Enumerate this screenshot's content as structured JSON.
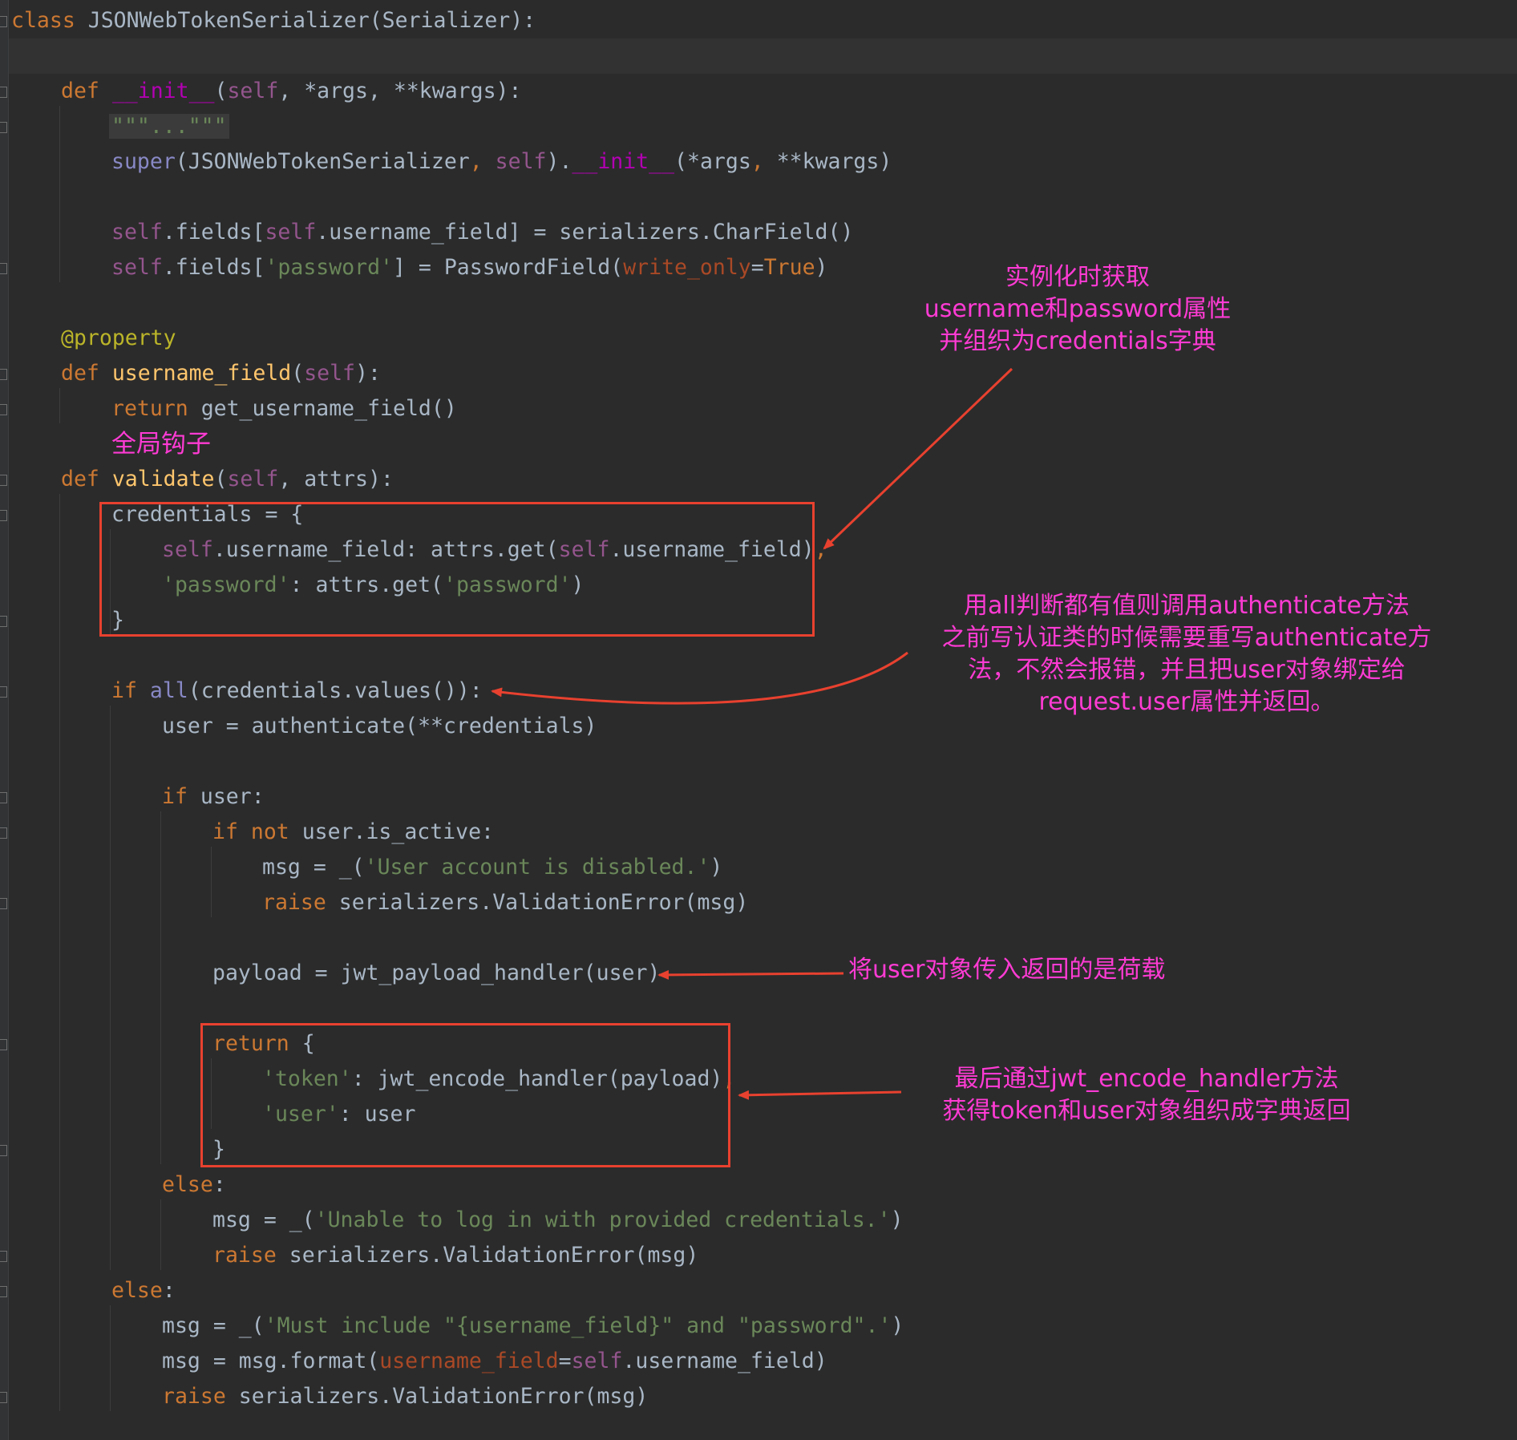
{
  "colors": {
    "background": "#2b2b2b",
    "keyword": "#cc7832",
    "function": "#ffc66d",
    "string": "#6a8759",
    "self": "#94558d",
    "annotation": "#ff3bd4",
    "box": "#e8412f"
  },
  "code": {
    "l01": {
      "a": "class",
      "b": " JSONWebTokenSerializer(Serializer):"
    },
    "l03": {
      "a": "def",
      "b": "__init__",
      "c": "(",
      "d": "self",
      "e": ", *args",
      "f": ", ",
      "g": "**kwargs):"
    },
    "l04": {
      "a": "\"\"\"...\"\"\""
    },
    "l05": {
      "a": "super",
      "b": "(JSONWebTokenSerializer",
      "c": ", ",
      "d": "self",
      "e": ").",
      "f": "__init__",
      "g": "(*args",
      "h": ", ",
      "i": "**kwargs)"
    },
    "l07": {
      "a": "self",
      "b": ".fields[",
      "c": "self",
      "d": ".username_field] = serializers.CharField()"
    },
    "l08": {
      "a": "self",
      "b": ".fields[",
      "c": "'password'",
      "d": "] = PasswordField(",
      "e": "write_only",
      "f": "=",
      "g": "True",
      "h": ")"
    },
    "l10": {
      "a": "@property"
    },
    "l11": {
      "a": "def",
      "b": "username_field",
      "c": "(",
      "d": "self",
      "e": "):"
    },
    "l12": {
      "a": "return",
      "b": " get_username_field()"
    },
    "l13": {
      "a": "全局钩子"
    },
    "l14": {
      "a": "def",
      "b": "validate",
      "c": "(",
      "d": "self",
      "e": ", attrs):"
    },
    "l15": {
      "a": "credentials = {"
    },
    "l16": {
      "a": "self",
      "b": ".username_field: attrs.get(",
      "c": "self",
      "d": ".username_field)",
      "e": ","
    },
    "l17": {
      "a": "'password'",
      "b": ": attrs.get(",
      "c": "'password'",
      "d": ")"
    },
    "l18": {
      "a": "}"
    },
    "l20": {
      "a": "if",
      "b": " ",
      "c": "all",
      "d": "(credentials.values()):"
    },
    "l21": {
      "a": "user = authenticate(**credentials)"
    },
    "l23": {
      "a": "if",
      "b": " user:"
    },
    "l24": {
      "a": "if not",
      "b": " user.is_active:"
    },
    "l25": {
      "a": "msg = _(",
      "b": "'User account is disabled.'",
      "c": ")"
    },
    "l26": {
      "a": "raise",
      "b": " serializers.ValidationError(msg)"
    },
    "l28": {
      "a": "payload = jwt_payload_handler(user)"
    },
    "l30": {
      "a": "return",
      "b": " {"
    },
    "l31": {
      "a": "'token'",
      "b": ": jwt_encode_handler(payload)",
      "c": ","
    },
    "l32": {
      "a": "'user'",
      "b": ": user"
    },
    "l33": {
      "a": "}"
    },
    "l34": {
      "a": "else",
      "b": ":"
    },
    "l35": {
      "a": "msg = _(",
      "b": "'Unable to log in with provided credentials.'",
      "c": ")"
    },
    "l36": {
      "a": "raise",
      "b": " serializers.ValidationError(msg)"
    },
    "l37": {
      "a": "else",
      "b": ":"
    },
    "l38": {
      "a": "msg = _(",
      "b": "'Must include \"{username_field}\" and \"password\".'",
      "c": ")"
    },
    "l39": {
      "a": "msg = msg.format(",
      "b": "username_field",
      "c": "=",
      "d": "self",
      "e": ".username_field)"
    },
    "l40": {
      "a": "raise",
      "b": " serializers.ValidationError(msg)"
    }
  },
  "annotations": {
    "credentials_note": [
      "实例化时获取",
      "username和password属性",
      "并组织为credentials字典"
    ],
    "all_note": [
      "用all判断都有值则调用authenticate方法",
      "之前写认证类的时候需要重写authenticate方",
      "法，不然会报错，并且把user对象绑定给",
      "request.user属性并返回。"
    ],
    "payload_note": "将user对象传入返回的是荷载",
    "return_note": [
      "最后通过jwt_encode_handler方法",
      "获得token和user对象组织成字典返回"
    ]
  }
}
